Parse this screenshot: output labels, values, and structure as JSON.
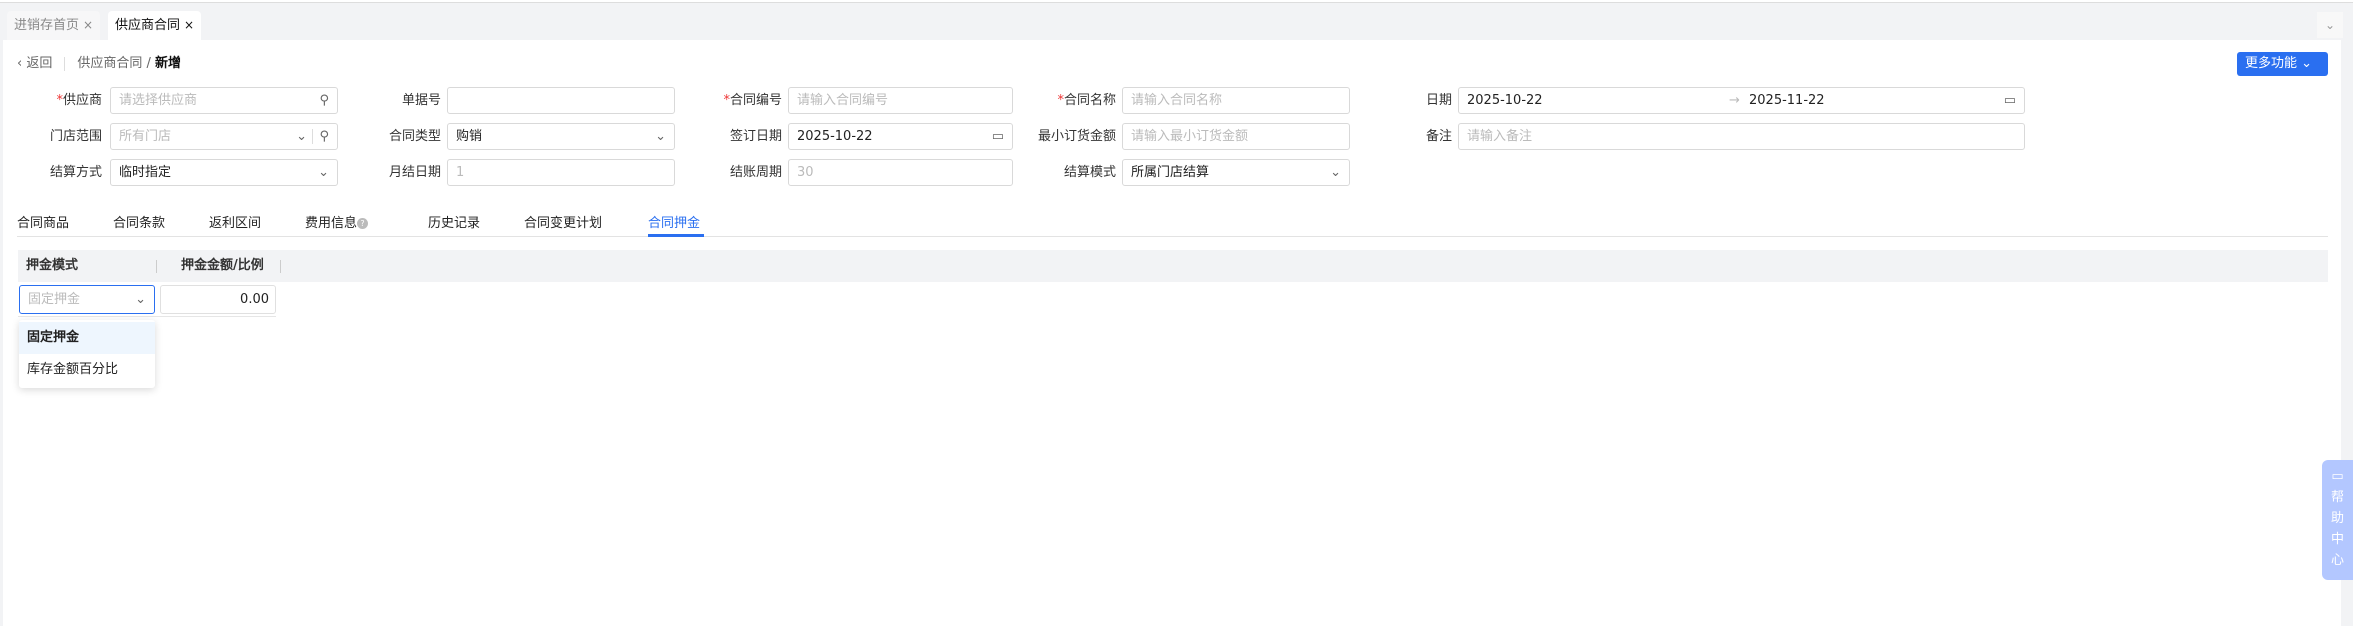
{
  "page_tabs": [
    {
      "label": "进销存首页",
      "close": "×"
    },
    {
      "label": "供应商合同",
      "close": "×"
    }
  ],
  "collapse_icon": "chevron-down-icon",
  "header": {
    "back": "返回",
    "breadcrumb_parent": "供应商合同",
    "breadcrumb_sep": "/",
    "breadcrumb_current": "新增",
    "more_button": "更多功能"
  },
  "form": {
    "supplier": {
      "label": "供应商",
      "required": true,
      "placeholder": "请选择供应商"
    },
    "doc_no": {
      "label": "单据号",
      "value": ""
    },
    "contract_no": {
      "label": "合同编号",
      "required": true,
      "placeholder": "请输入合同编号"
    },
    "contract_name": {
      "label": "合同名称",
      "required": true,
      "placeholder": "请输入合同名称"
    },
    "date": {
      "label": "日期",
      "start": "2025-10-22",
      "arrow": "→",
      "end": "2025-11-22"
    },
    "store_scope": {
      "label": "门店范围",
      "placeholder": "所有门店"
    },
    "contract_type": {
      "label": "合同类型",
      "value": "购销"
    },
    "sign_date": {
      "label": "签订日期",
      "value": "2025-10-22"
    },
    "min_order": {
      "label": "最小订货金额",
      "placeholder": "请输入最小订货金额"
    },
    "remark": {
      "label": "备注",
      "placeholder": "请输入备注"
    },
    "settle_method": {
      "label": "结算方式",
      "value": "临时指定"
    },
    "monthly_day": {
      "label": "月结日期",
      "placeholder": "1"
    },
    "settle_cycle": {
      "label": "结账周期",
      "placeholder": "30"
    },
    "settle_mode": {
      "label": "结算模式",
      "value": "所属门店结算"
    }
  },
  "content_tabs": [
    "合同商品",
    "合同条款",
    "返利区间",
    "费用信息",
    "历史记录",
    "合同变更计划",
    "合同押金"
  ],
  "active_tab": "合同押金",
  "accent": "#2a6ff0",
  "table": {
    "headers": [
      "押金模式",
      "押金金额/比例"
    ],
    "row": {
      "mode_placeholder": "固定押金",
      "amount": "0.00"
    }
  },
  "dropdown": {
    "options": [
      "固定押金",
      "库存金额百分比"
    ],
    "selected": "固定押金"
  },
  "help": {
    "chars": [
      "帮",
      "助",
      "中",
      "心"
    ]
  }
}
